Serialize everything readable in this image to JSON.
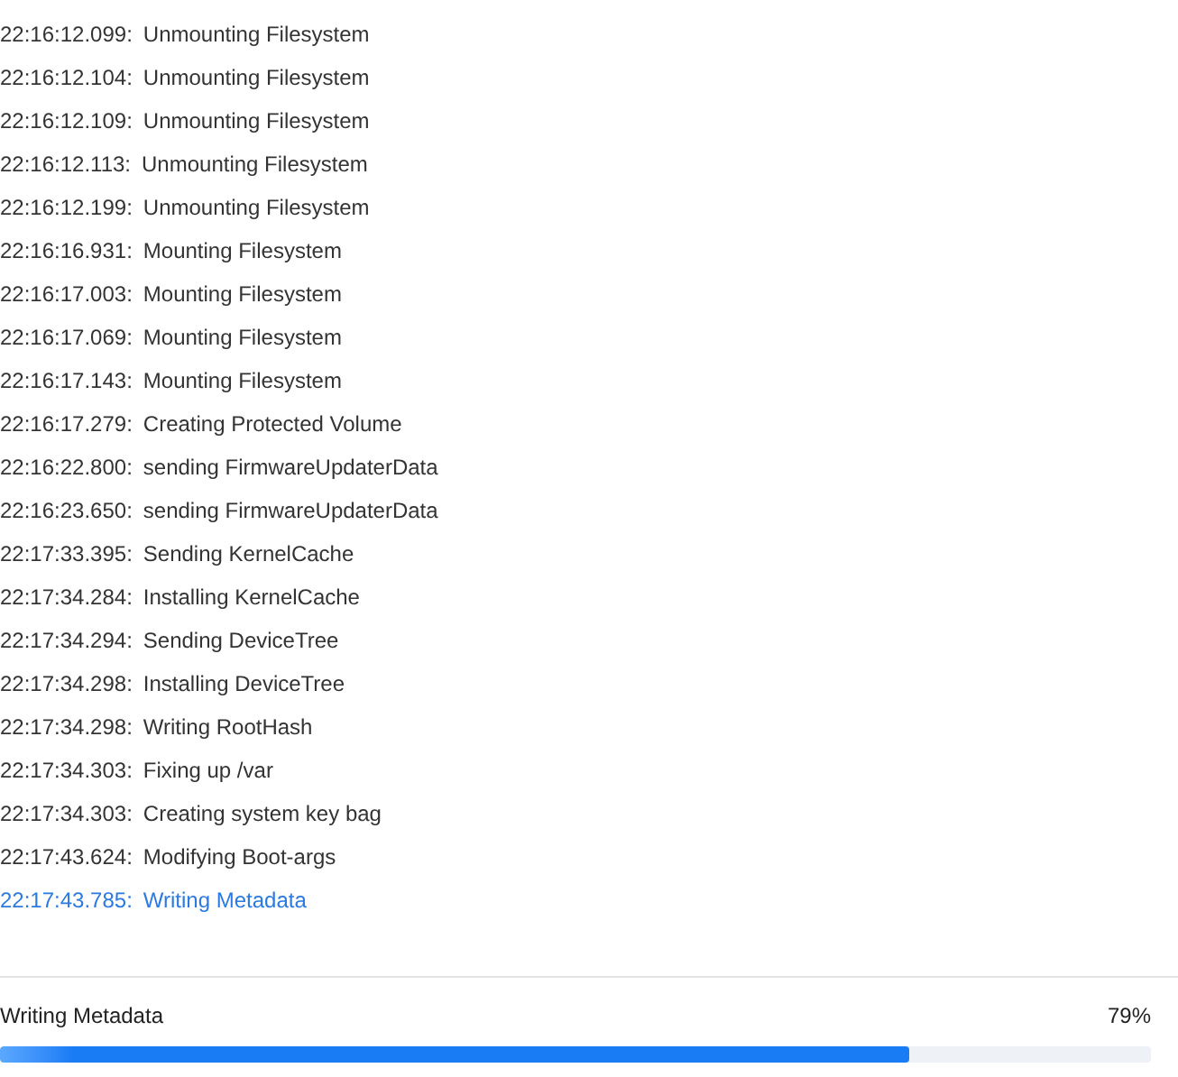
{
  "log": [
    {
      "time": "22:16:12.099:",
      "message": "Unmounting Filesystem",
      "current": false
    },
    {
      "time": "22:16:12.104:",
      "message": "Unmounting Filesystem",
      "current": false
    },
    {
      "time": "22:16:12.109:",
      "message": "Unmounting Filesystem",
      "current": false
    },
    {
      "time": "22:16:12.113:",
      "message": "Unmounting Filesystem",
      "current": false
    },
    {
      "time": "22:16:12.199:",
      "message": "Unmounting Filesystem",
      "current": false
    },
    {
      "time": "22:16:16.931:",
      "message": "Mounting Filesystem",
      "current": false
    },
    {
      "time": "22:16:17.003:",
      "message": "Mounting Filesystem",
      "current": false
    },
    {
      "time": "22:16:17.069:",
      "message": "Mounting Filesystem",
      "current": false
    },
    {
      "time": "22:16:17.143:",
      "message": "Mounting Filesystem",
      "current": false
    },
    {
      "time": "22:16:17.279:",
      "message": "Creating Protected Volume",
      "current": false
    },
    {
      "time": "22:16:22.800:",
      "message": "sending FirmwareUpdaterData",
      "current": false
    },
    {
      "time": "22:16:23.650:",
      "message": "sending FirmwareUpdaterData",
      "current": false
    },
    {
      "time": "22:17:33.395:",
      "message": "Sending KernelCache",
      "current": false
    },
    {
      "time": "22:17:34.284:",
      "message": "Installing KernelCache",
      "current": false
    },
    {
      "time": "22:17:34.294:",
      "message": "Sending DeviceTree",
      "current": false
    },
    {
      "time": "22:17:34.298:",
      "message": "Installing DeviceTree",
      "current": false
    },
    {
      "time": "22:17:34.298:",
      "message": "Writing RootHash",
      "current": false
    },
    {
      "time": "22:17:34.303:",
      "message": "Fixing up /var",
      "current": false
    },
    {
      "time": "22:17:34.303:",
      "message": "Creating system key bag",
      "current": false
    },
    {
      "time": "22:17:43.624:",
      "message": "Modifying Boot-args",
      "current": false
    },
    {
      "time": "22:17:43.785:",
      "message": "Writing Metadata",
      "current": true
    }
  ],
  "progress": {
    "label": "Writing Metadata",
    "percent": "79%",
    "level": 0.79
  }
}
